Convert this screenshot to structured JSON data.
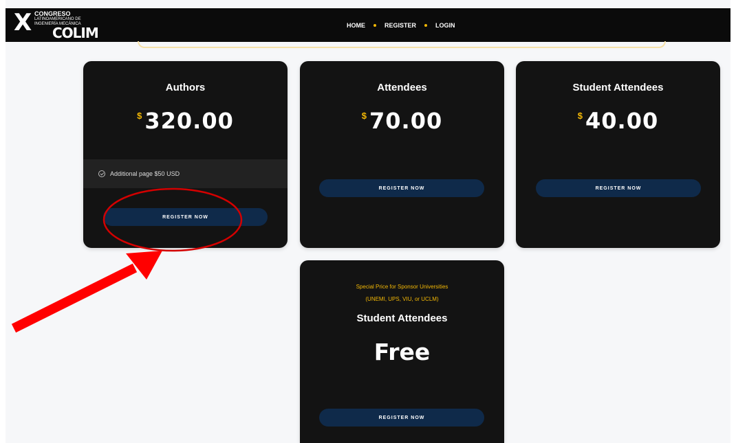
{
  "header": {
    "logo": {
      "numeral": "X",
      "line1": "CONGRESO",
      "line2": "LATINOAMERICANO DE",
      "line3": "INGENIERÍA MECÁNICA",
      "line4": "COLIM"
    },
    "nav": [
      {
        "label": "HOME"
      },
      {
        "label": "REGISTER"
      },
      {
        "label": "LOGIN"
      }
    ]
  },
  "cards": [
    {
      "title": "Authors",
      "currency": "$",
      "price": "320.00",
      "feature": "Additional page $50 USD",
      "button": "REGISTER NOW"
    },
    {
      "title": "Attendees",
      "currency": "$",
      "price": "70.00",
      "button": "REGISTER NOW"
    },
    {
      "title": "Student Attendees",
      "currency": "$",
      "price": "40.00",
      "button": "REGISTER NOW"
    },
    {
      "special_line1": "Special Price for Sponsor Universities",
      "special_line2": "(UNEMI, UPS, VIU, or UCLM)",
      "title": "Student Attendees",
      "price": "Free",
      "button": "REGISTER NOW"
    }
  ],
  "colors": {
    "accent": "#f2b705",
    "card_bg": "#131313",
    "button_bg": "#0f2a4a",
    "annotation": "#e00000"
  }
}
